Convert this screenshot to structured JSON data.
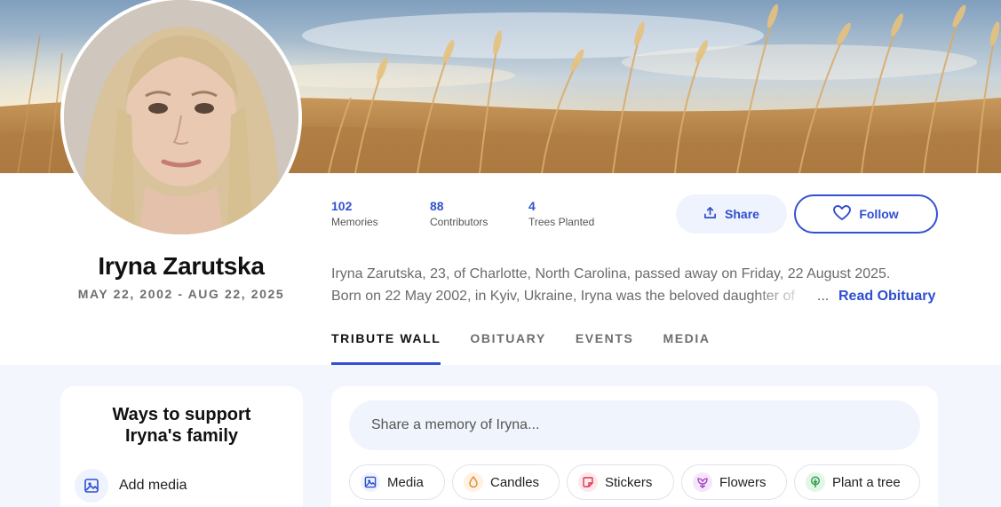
{
  "profile": {
    "name": "Iryna Zarutska",
    "dates": "MAY 22, 2002 - AUG 22, 2025"
  },
  "stats": [
    {
      "value": "102",
      "label": "Memories"
    },
    {
      "value": "88",
      "label": "Contributors"
    },
    {
      "value": "4",
      "label": "Trees Planted"
    }
  ],
  "actions": {
    "share_label": "Share",
    "follow_label": "Follow"
  },
  "bio": {
    "line1": "Iryna Zarutska, 23, of Charlotte, North Carolina, passed away on Friday, 22 August 2025.",
    "line2": "Born on 22 May 2002, in Kyiv, Ukraine, Iryna was the beloved daughter of",
    "ellipsis": "...",
    "read_more": "Read Obituary"
  },
  "tabs": [
    "TRIBUTE WALL",
    "OBITUARY",
    "EVENTS",
    "MEDIA"
  ],
  "active_tab": "TRIBUTE WALL",
  "support": {
    "title_line1": "Ways to support",
    "title_line2": "Iryna's family",
    "items": [
      {
        "label": "Add media",
        "icon": "image-icon"
      }
    ]
  },
  "post": {
    "placeholder": "Share a memory of Iryna...",
    "chips": [
      {
        "label": "Media",
        "icon": "image-icon"
      },
      {
        "label": "Candles",
        "icon": "candle-icon"
      },
      {
        "label": "Stickers",
        "icon": "sticker-icon"
      },
      {
        "label": "Flowers",
        "icon": "flower-icon"
      },
      {
        "label": "Plant a tree",
        "icon": "tree-icon"
      }
    ]
  },
  "colors": {
    "accent": "#3451d1",
    "accent_soft": "#eef3fd",
    "page_bg_lower": "#f3f6fd"
  }
}
